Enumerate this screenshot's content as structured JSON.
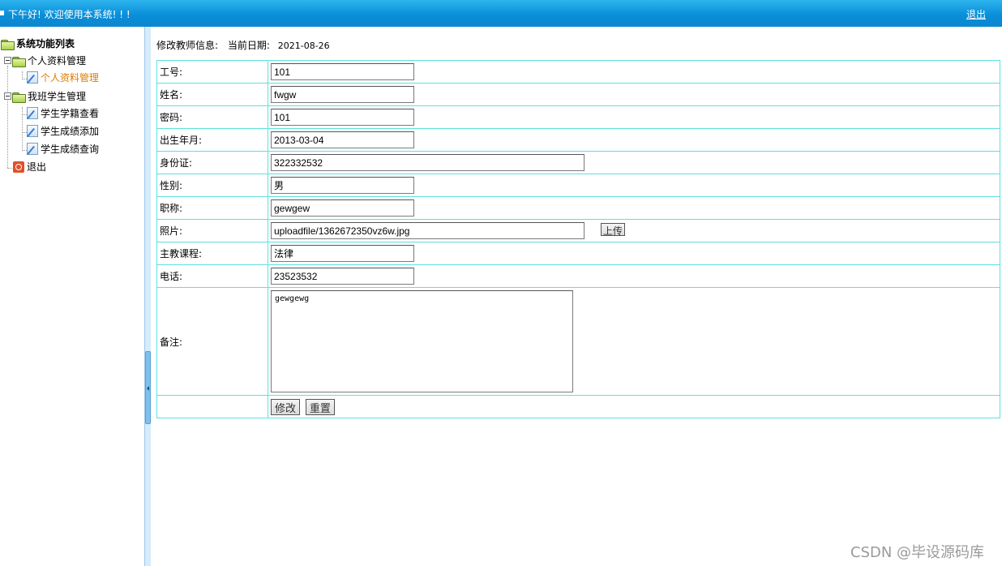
{
  "header": {
    "greeting": "下午好! 欢迎使用本系统! ! !",
    "logout_label": "退出"
  },
  "sidebar": {
    "root": "系统功能列表",
    "groups": [
      {
        "label": "个人资料管理",
        "items": [
          {
            "label": "个人资料管理",
            "active": true
          }
        ]
      },
      {
        "label": "我班学生管理",
        "items": [
          {
            "label": "学生学籍查看"
          },
          {
            "label": "学生成绩添加"
          },
          {
            "label": "学生成绩查询"
          }
        ]
      }
    ],
    "exit_label": "退出",
    "active_color": "#e07b00"
  },
  "main": {
    "title": "修改教师信息:",
    "date_label": "当前日期:",
    "date_value": "2021-08-26",
    "fields": {
      "id": {
        "label": "工号:",
        "value": "101"
      },
      "name": {
        "label": "姓名:",
        "value": "fwgw"
      },
      "password": {
        "label": "密码:",
        "value": "101"
      },
      "birth": {
        "label": "出生年月:",
        "value": "2013-03-04"
      },
      "idcard": {
        "label": "身份证:",
        "value": "322332532"
      },
      "gender": {
        "label": "性别:",
        "value": "男"
      },
      "title": {
        "label": "职称:",
        "value": "gewgew"
      },
      "photo": {
        "label": "照片:",
        "value": "uploadfile/1362672350vz6w.jpg",
        "upload_label": "上传"
      },
      "course": {
        "label": "主教课程:",
        "value": "法律"
      },
      "phone": {
        "label": "电话:",
        "value": "23523532"
      },
      "note": {
        "label": "备注:",
        "value": "gewgewg"
      }
    },
    "submit_label": "修改",
    "reset_label": "重置",
    "border_color": "#5fe0de"
  },
  "watermark": "CSDN @毕设源码库"
}
